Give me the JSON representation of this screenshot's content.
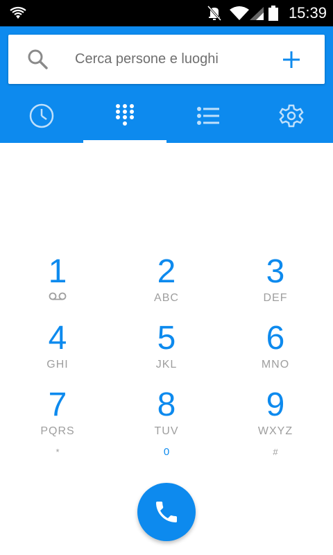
{
  "statusbar": {
    "time": "15:39",
    "icons": [
      "wifi-icon",
      "mute-icon",
      "wifi-signal-icon",
      "cell-signal-icon",
      "battery-icon"
    ]
  },
  "search": {
    "placeholder": "Cerca persone e luoghi",
    "icon": "search-icon",
    "add_icon": "plus-icon"
  },
  "tabs": [
    {
      "name": "recents",
      "icon": "clock-icon",
      "selected": false
    },
    {
      "name": "dialpad",
      "icon": "dialpad-icon",
      "selected": true
    },
    {
      "name": "contacts",
      "icon": "list-icon",
      "selected": false
    },
    {
      "name": "settings",
      "icon": "gear-icon",
      "selected": false
    }
  ],
  "dialpad": {
    "keys": [
      {
        "digit": "1",
        "letters": ""
      },
      {
        "digit": "2",
        "letters": "ABC"
      },
      {
        "digit": "3",
        "letters": "DEF"
      },
      {
        "digit": "4",
        "letters": "GHI"
      },
      {
        "digit": "5",
        "letters": "JKL"
      },
      {
        "digit": "6",
        "letters": "MNO"
      },
      {
        "digit": "7",
        "letters": "PQRS"
      },
      {
        "digit": "8",
        "letters": "TUV"
      },
      {
        "digit": "9",
        "letters": "WXYZ"
      }
    ],
    "star": "*",
    "zero": "0",
    "hash": "#"
  },
  "colors": {
    "accent": "#0d8aee",
    "statusbar": "#000000",
    "muted_text": "#9e9e9e"
  },
  "call_button": {
    "icon": "phone-icon"
  }
}
